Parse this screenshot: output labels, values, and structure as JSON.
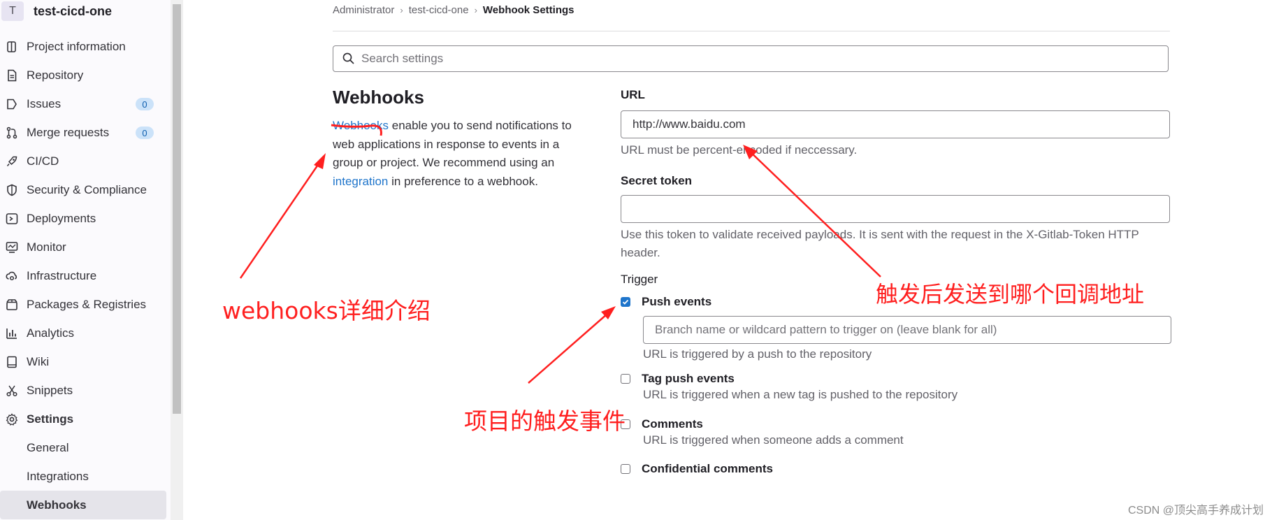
{
  "sidebar": {
    "project_avatar": "T",
    "project_name": "test-cicd-one",
    "items": [
      {
        "label": "Project information",
        "icon": "project-info-icon"
      },
      {
        "label": "Repository",
        "icon": "repository-icon"
      },
      {
        "label": "Issues",
        "icon": "issues-icon",
        "badge": "0"
      },
      {
        "label": "Merge requests",
        "icon": "merge-requests-icon",
        "badge": "0"
      },
      {
        "label": "CI/CD",
        "icon": "rocket-icon"
      },
      {
        "label": "Security & Compliance",
        "icon": "shield-icon"
      },
      {
        "label": "Deployments",
        "icon": "deployments-icon"
      },
      {
        "label": "Monitor",
        "icon": "monitor-icon"
      },
      {
        "label": "Infrastructure",
        "icon": "cloud-gear-icon"
      },
      {
        "label": "Packages & Registries",
        "icon": "package-icon"
      },
      {
        "label": "Analytics",
        "icon": "chart-icon"
      },
      {
        "label": "Wiki",
        "icon": "book-icon"
      },
      {
        "label": "Snippets",
        "icon": "scissors-icon"
      },
      {
        "label": "Settings",
        "icon": "gear-icon"
      },
      {
        "label": "General"
      },
      {
        "label": "Integrations"
      },
      {
        "label": "Webhooks"
      }
    ]
  },
  "breadcrumb": [
    "Administrator",
    "test-cicd-one",
    "Webhook Settings"
  ],
  "search": {
    "placeholder": "Search settings"
  },
  "webhooks": {
    "title": "Webhooks",
    "desc_link1": "Webhooks",
    "desc_part1": " enable you to send notifications to web applications in response to events in a group or project. We recommend using an ",
    "desc_link2": "integration",
    "desc_part2": " in preference to a webhook."
  },
  "form": {
    "url_label": "URL",
    "url_value": "http://www.baidu.com",
    "url_help": "URL must be percent-encoded if neccessary.",
    "secret_label": "Secret token",
    "secret_value": "",
    "secret_help": "Use this token to validate received payloads. It is sent with the request in the X-Gitlab-Token HTTP header.",
    "trigger_label": "Trigger",
    "triggers": [
      {
        "label": "Push events",
        "checked": true,
        "help": "URL is triggered by a push to the repository",
        "branch_placeholder": "Branch name or wildcard pattern to trigger on (leave blank for all)"
      },
      {
        "label": "Tag push events",
        "checked": false,
        "help": "URL is triggered when a new tag is pushed to the repository"
      },
      {
        "label": "Comments",
        "checked": false,
        "help": "URL is triggered when someone adds a comment"
      },
      {
        "label": "Confidential comments",
        "checked": false,
        "help": ""
      }
    ]
  },
  "annotations": {
    "webhooks_intro": "webhooks详细介绍",
    "callback_address": "触发后发送到哪个回调地址",
    "trigger_events": "项目的触发事件"
  },
  "watermark": "CSDN @顶尖高手养成计划",
  "colors": {
    "link": "#1f75cb",
    "annotation": "#ff1f1f",
    "checkbox": "#1f75cb"
  }
}
